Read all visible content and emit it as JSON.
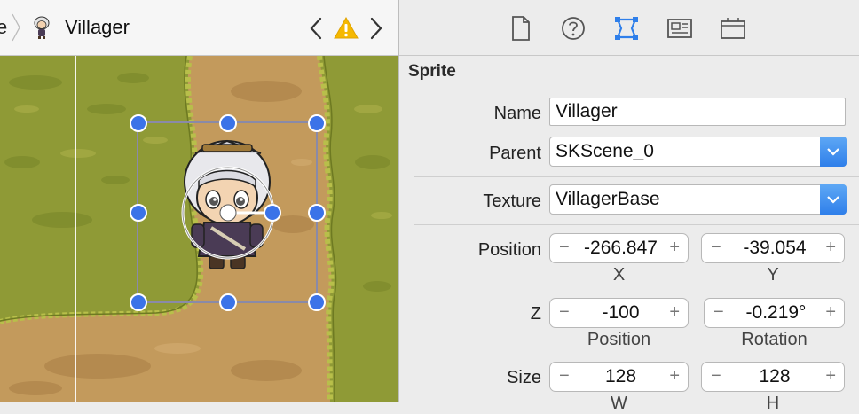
{
  "jumpbar": {
    "prev_crumb": "e",
    "current_crumb": "Villager",
    "icons": {
      "separator": "chevron-right-icon",
      "node": "villager-sprite-icon",
      "back": "chevron-left-icon",
      "warning": "warning-icon",
      "forward": "chevron-right-icon"
    },
    "warning_color": "#f5b800"
  },
  "inspector_tabs": [
    {
      "name": "file-inspector",
      "icon": "document-icon",
      "selected": false
    },
    {
      "name": "quick-help",
      "icon": "question-icon",
      "selected": false
    },
    {
      "name": "attributes-inspector",
      "icon": "attributes-icon",
      "selected": true
    },
    {
      "name": "library",
      "icon": "media-library-icon",
      "selected": false
    },
    {
      "name": "object-library",
      "icon": "object-library-icon",
      "selected": false
    }
  ],
  "inspector": {
    "section_title": "Sprite",
    "name_label": "Name",
    "name_value": "Villager",
    "parent_label": "Parent",
    "parent_value": "SKScene_0",
    "texture_label": "Texture",
    "texture_value": "VillagerBase",
    "position_label": "Position",
    "position_x": "-266.847",
    "position_y": "-39.054",
    "x_label": "X",
    "y_label": "Y",
    "z_label": "Z",
    "z_value": "-100",
    "rotation_value": "-0.219°",
    "z_sublabel": "Position",
    "rotation_sublabel": "Rotation",
    "size_label": "Size",
    "size_w": "128",
    "size_h": "128",
    "w_label": "W",
    "h_label": "H",
    "minus": "−",
    "plus": "+"
  },
  "colors": {
    "accent": "#2f7fea",
    "handle": "#3b73e8",
    "grass": "#8f9a36",
    "path": "#c39a5c"
  }
}
